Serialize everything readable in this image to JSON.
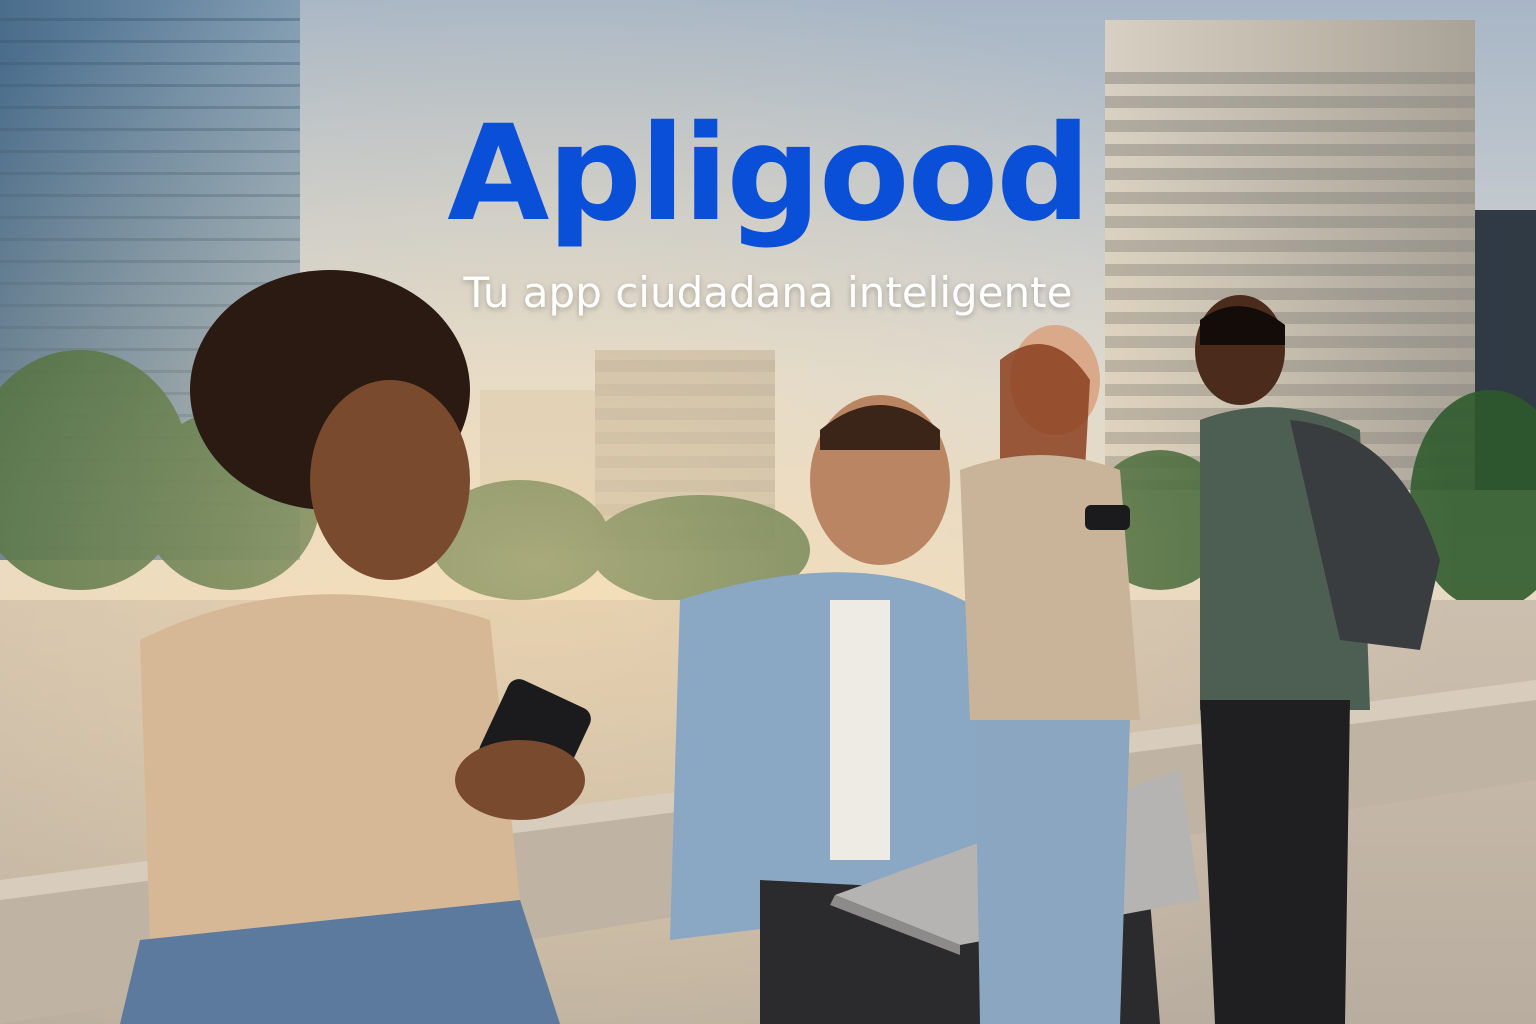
{
  "hero": {
    "brand": "Apligood",
    "tagline": "Tu app ciudadana inteligente"
  },
  "colors": {
    "brand": "#0a4fd8",
    "tagline": "#ffffff",
    "sky_top": "#aab8c8",
    "sky_bottom": "#e9dcc8",
    "pavement": "#cfc6b8"
  },
  "scene": {
    "description_tag": "four-people-in-city-plaza-with-phones-and-laptop"
  }
}
